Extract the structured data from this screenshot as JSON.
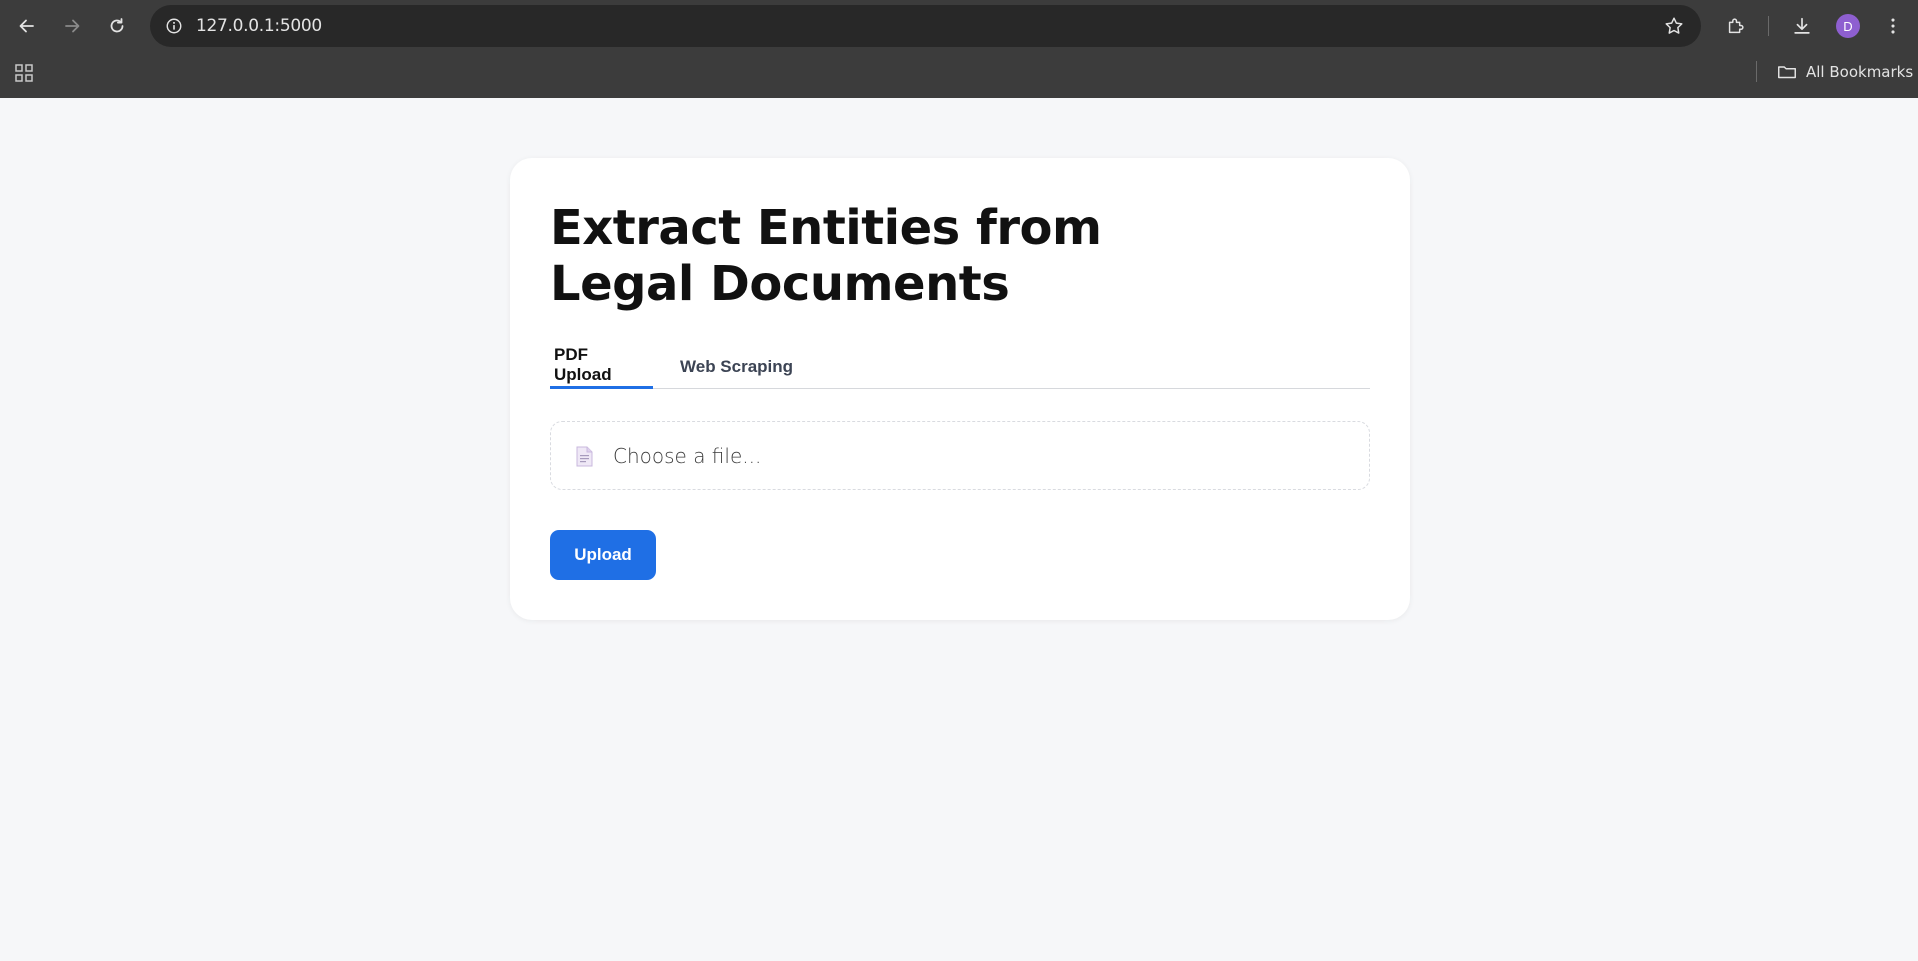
{
  "browser": {
    "url": "127.0.0.1:5000",
    "avatar_initial": "D",
    "bookmarks_label": "All Bookmarks",
    "icons": [
      "back-arrow-icon",
      "forward-arrow-icon",
      "reload-icon",
      "site-info-icon",
      "bookmark-star-icon",
      "extensions-icon",
      "download-icon",
      "more-vert-icon",
      "apps-grid-icon",
      "folder-icon"
    ]
  },
  "page": {
    "title_line1": "Extract Entities from",
    "title_line2": "Legal Documents",
    "tabs": [
      {
        "label": "PDF Upload",
        "active": true
      },
      {
        "label": "Web Scraping",
        "active": false
      }
    ],
    "file_input": {
      "placeholder": "Choose a file...",
      "icon": "document-icon"
    },
    "upload_button": "Upload"
  },
  "colors": {
    "accent": "#1f6fe5",
    "chrome_bg": "#3c3c3c",
    "page_bg": "#f6f7f9",
    "avatar": "#8e5fd0"
  }
}
